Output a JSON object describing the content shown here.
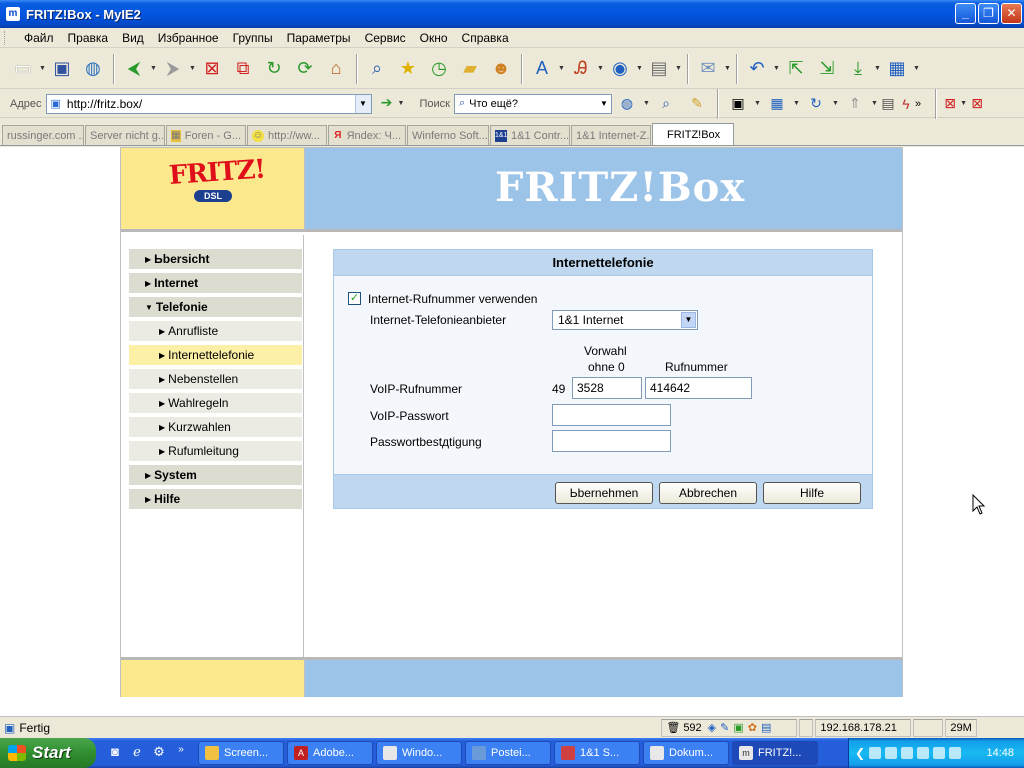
{
  "window": {
    "title": "FRITZ!Box - MyIE2"
  },
  "menu": [
    "Файл",
    "Правка",
    "Вид",
    "Избранное",
    "Группы",
    "Параметры",
    "Сервис",
    "Окно",
    "Справка"
  ],
  "address": {
    "label": "Адрес",
    "url": "http://fritz.box/",
    "search_label": "Поиск",
    "search_value": "Что ещё?"
  },
  "tabs": [
    {
      "label": "russinger.com ...",
      "icon": "page-icon"
    },
    {
      "label": "Server nicht g...",
      "icon": "page-icon"
    },
    {
      "label": "Foren - G...",
      "icon": "forum-icon"
    },
    {
      "label": "http://ww...",
      "icon": "smiley-icon"
    },
    {
      "label": "Яndex: Ч...",
      "icon": "yandex-icon"
    },
    {
      "label": "Winferno Soft...",
      "icon": "page-icon"
    },
    {
      "label": "1&1 Contr...",
      "icon": "1und1-icon"
    },
    {
      "label": "1&1 Internet-Z...",
      "icon": "page-icon"
    },
    {
      "label": "FRITZ!Box",
      "icon": "",
      "active": true
    }
  ],
  "page": {
    "brand": "FRITZ!",
    "brand_sub": "DSL",
    "banner": "FRITZ!Box",
    "nav": [
      {
        "label": "Ьbersicht",
        "level": 0,
        "expanded": false
      },
      {
        "label": "Internet",
        "level": 0,
        "expanded": false
      },
      {
        "label": "Telefonie",
        "level": 0,
        "expanded": true
      },
      {
        "label": "Anrufliste",
        "level": 1
      },
      {
        "label": "Internettelefonie",
        "level": 1,
        "active": true
      },
      {
        "label": "Nebenstellen",
        "level": 1
      },
      {
        "label": "Wahlregeln",
        "level": 1
      },
      {
        "label": "Kurzwahlen",
        "level": 1
      },
      {
        "label": "Rufumleitung",
        "level": 1
      },
      {
        "label": "System",
        "level": 0,
        "expanded": false
      },
      {
        "label": "Hilfe",
        "level": 0,
        "expanded": false
      }
    ],
    "panel": {
      "title": "Internettelefonie",
      "use_number_label": "Internet-Rufnummer verwenden",
      "use_number_checked": true,
      "provider_label": "Internet-Telefonieanbieter",
      "provider_value": "1&1 Internet",
      "col_prefix_line1": "Vorwahl",
      "col_prefix_line2": "ohne 0",
      "col_number": "Rufnummer",
      "voip_number_label": "VoIP-Rufnummer",
      "country_code": "49",
      "prefix_value": "3528",
      "number_value": "414642",
      "voip_password_label": "VoIP-Passwort",
      "voip_password_value": "",
      "password_confirm_label": "Passwortbestдtigung",
      "password_confirm_value": "",
      "btn_apply": "Ьbernehmen",
      "btn_cancel": "Abbrechen",
      "btn_help": "Hilfe"
    }
  },
  "status": {
    "text": "Fertig",
    "count": "592",
    "ip": "192.168.178.21",
    "mem": "29M"
  },
  "taskbar": {
    "start": "Start",
    "tasks": [
      {
        "label": "Screen...",
        "active": false
      },
      {
        "label": "Adobe...",
        "active": false
      },
      {
        "label": "Windo...",
        "active": false
      },
      {
        "label": "Postei...",
        "active": false
      },
      {
        "label": "1&1 S...",
        "active": false
      },
      {
        "label": "Dokum...",
        "active": false
      },
      {
        "label": "FRITZ!...",
        "active": true
      }
    ],
    "clock": "14:48"
  },
  "colors": {
    "header_yellow": "#fce98d",
    "header_blue": "#9cc3e8",
    "panel_head": "#bfd8f0",
    "xp_blue": "#245edb"
  }
}
